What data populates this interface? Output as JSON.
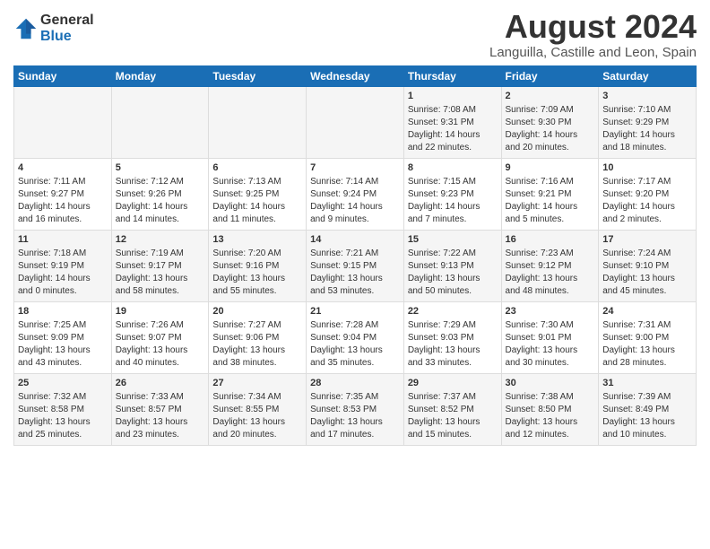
{
  "header": {
    "logo_general": "General",
    "logo_blue": "Blue",
    "month_title": "August 2024",
    "location": "Languilla, Castille and Leon, Spain"
  },
  "days_of_week": [
    "Sunday",
    "Monday",
    "Tuesday",
    "Wednesday",
    "Thursday",
    "Friday",
    "Saturday"
  ],
  "weeks": [
    [
      {
        "day": "",
        "info": ""
      },
      {
        "day": "",
        "info": ""
      },
      {
        "day": "",
        "info": ""
      },
      {
        "day": "",
        "info": ""
      },
      {
        "day": "1",
        "info": "Sunrise: 7:08 AM\nSunset: 9:31 PM\nDaylight: 14 hours\nand 22 minutes."
      },
      {
        "day": "2",
        "info": "Sunrise: 7:09 AM\nSunset: 9:30 PM\nDaylight: 14 hours\nand 20 minutes."
      },
      {
        "day": "3",
        "info": "Sunrise: 7:10 AM\nSunset: 9:29 PM\nDaylight: 14 hours\nand 18 minutes."
      }
    ],
    [
      {
        "day": "4",
        "info": "Sunrise: 7:11 AM\nSunset: 9:27 PM\nDaylight: 14 hours\nand 16 minutes."
      },
      {
        "day": "5",
        "info": "Sunrise: 7:12 AM\nSunset: 9:26 PM\nDaylight: 14 hours\nand 14 minutes."
      },
      {
        "day": "6",
        "info": "Sunrise: 7:13 AM\nSunset: 9:25 PM\nDaylight: 14 hours\nand 11 minutes."
      },
      {
        "day": "7",
        "info": "Sunrise: 7:14 AM\nSunset: 9:24 PM\nDaylight: 14 hours\nand 9 minutes."
      },
      {
        "day": "8",
        "info": "Sunrise: 7:15 AM\nSunset: 9:23 PM\nDaylight: 14 hours\nand 7 minutes."
      },
      {
        "day": "9",
        "info": "Sunrise: 7:16 AM\nSunset: 9:21 PM\nDaylight: 14 hours\nand 5 minutes."
      },
      {
        "day": "10",
        "info": "Sunrise: 7:17 AM\nSunset: 9:20 PM\nDaylight: 14 hours\nand 2 minutes."
      }
    ],
    [
      {
        "day": "11",
        "info": "Sunrise: 7:18 AM\nSunset: 9:19 PM\nDaylight: 14 hours\nand 0 minutes."
      },
      {
        "day": "12",
        "info": "Sunrise: 7:19 AM\nSunset: 9:17 PM\nDaylight: 13 hours\nand 58 minutes."
      },
      {
        "day": "13",
        "info": "Sunrise: 7:20 AM\nSunset: 9:16 PM\nDaylight: 13 hours\nand 55 minutes."
      },
      {
        "day": "14",
        "info": "Sunrise: 7:21 AM\nSunset: 9:15 PM\nDaylight: 13 hours\nand 53 minutes."
      },
      {
        "day": "15",
        "info": "Sunrise: 7:22 AM\nSunset: 9:13 PM\nDaylight: 13 hours\nand 50 minutes."
      },
      {
        "day": "16",
        "info": "Sunrise: 7:23 AM\nSunset: 9:12 PM\nDaylight: 13 hours\nand 48 minutes."
      },
      {
        "day": "17",
        "info": "Sunrise: 7:24 AM\nSunset: 9:10 PM\nDaylight: 13 hours\nand 45 minutes."
      }
    ],
    [
      {
        "day": "18",
        "info": "Sunrise: 7:25 AM\nSunset: 9:09 PM\nDaylight: 13 hours\nand 43 minutes."
      },
      {
        "day": "19",
        "info": "Sunrise: 7:26 AM\nSunset: 9:07 PM\nDaylight: 13 hours\nand 40 minutes."
      },
      {
        "day": "20",
        "info": "Sunrise: 7:27 AM\nSunset: 9:06 PM\nDaylight: 13 hours\nand 38 minutes."
      },
      {
        "day": "21",
        "info": "Sunrise: 7:28 AM\nSunset: 9:04 PM\nDaylight: 13 hours\nand 35 minutes."
      },
      {
        "day": "22",
        "info": "Sunrise: 7:29 AM\nSunset: 9:03 PM\nDaylight: 13 hours\nand 33 minutes."
      },
      {
        "day": "23",
        "info": "Sunrise: 7:30 AM\nSunset: 9:01 PM\nDaylight: 13 hours\nand 30 minutes."
      },
      {
        "day": "24",
        "info": "Sunrise: 7:31 AM\nSunset: 9:00 PM\nDaylight: 13 hours\nand 28 minutes."
      }
    ],
    [
      {
        "day": "25",
        "info": "Sunrise: 7:32 AM\nSunset: 8:58 PM\nDaylight: 13 hours\nand 25 minutes."
      },
      {
        "day": "26",
        "info": "Sunrise: 7:33 AM\nSunset: 8:57 PM\nDaylight: 13 hours\nand 23 minutes."
      },
      {
        "day": "27",
        "info": "Sunrise: 7:34 AM\nSunset: 8:55 PM\nDaylight: 13 hours\nand 20 minutes."
      },
      {
        "day": "28",
        "info": "Sunrise: 7:35 AM\nSunset: 8:53 PM\nDaylight: 13 hours\nand 17 minutes."
      },
      {
        "day": "29",
        "info": "Sunrise: 7:37 AM\nSunset: 8:52 PM\nDaylight: 13 hours\nand 15 minutes."
      },
      {
        "day": "30",
        "info": "Sunrise: 7:38 AM\nSunset: 8:50 PM\nDaylight: 13 hours\nand 12 minutes."
      },
      {
        "day": "31",
        "info": "Sunrise: 7:39 AM\nSunset: 8:49 PM\nDaylight: 13 hours\nand 10 minutes."
      }
    ]
  ]
}
